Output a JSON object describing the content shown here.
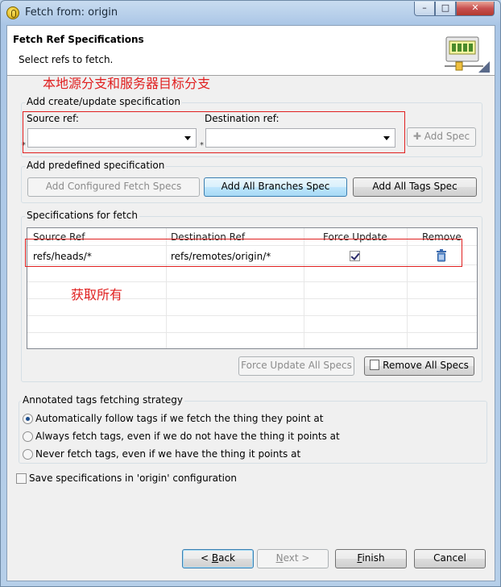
{
  "window": {
    "title": "Fetch from: origin",
    "min_glyph": "–",
    "max_glyph": "□",
    "close_glyph": "✕"
  },
  "header": {
    "title": "Fetch Ref Specifications",
    "description": "Select refs to fetch.",
    "annotation": "本地源分支和服务器目标分支"
  },
  "create_spec": {
    "group_label": "Add create/update specification",
    "source_label": "Source ref:",
    "destination_label": "Destination ref:",
    "source_value": "",
    "destination_value": "",
    "required_marker": "*",
    "add_spec_label": "Add Spec"
  },
  "predefined": {
    "group_label": "Add predefined specification",
    "configured_label": "Add Configured Fetch Specs",
    "branches_label": "Add All Branches Spec",
    "tags_label": "Add All Tags Spec"
  },
  "specs": {
    "group_label": "Specifications for fetch",
    "columns": [
      "Source Ref",
      "Destination Ref",
      "Force Update",
      "Remove"
    ],
    "rows": [
      {
        "source": "refs/heads/*",
        "destination": "refs/remotes/origin/*",
        "force_update": true
      }
    ],
    "annotation": "获取所有",
    "force_all_label": "Force Update All Specs",
    "remove_all_label": "Remove All Specs"
  },
  "tags": {
    "group_label": "Annotated tags fetching strategy",
    "options": [
      {
        "label": "Automatically follow tags if we fetch the thing they point at",
        "selected": true
      },
      {
        "label": "Always fetch tags, even if we do not have the thing it points at",
        "selected": false
      },
      {
        "label": "Never fetch tags, even if we have the thing it points at",
        "selected": false
      }
    ]
  },
  "save_config": {
    "label": "Save specifications in 'origin' configuration",
    "checked": false
  },
  "footer": {
    "back_prefix": "< ",
    "back_mnemonic": "B",
    "back_rest": "ack",
    "next_prefix": "",
    "next_mnemonic": "N",
    "next_rest": "ext >",
    "finish_mnemonic": "F",
    "finish_rest": "inish",
    "cancel_label": "Cancel"
  },
  "colors": {
    "annotation": "#e02020",
    "window_frame": "#b9d1ea",
    "dialog_bg": "#f0f0f0"
  }
}
